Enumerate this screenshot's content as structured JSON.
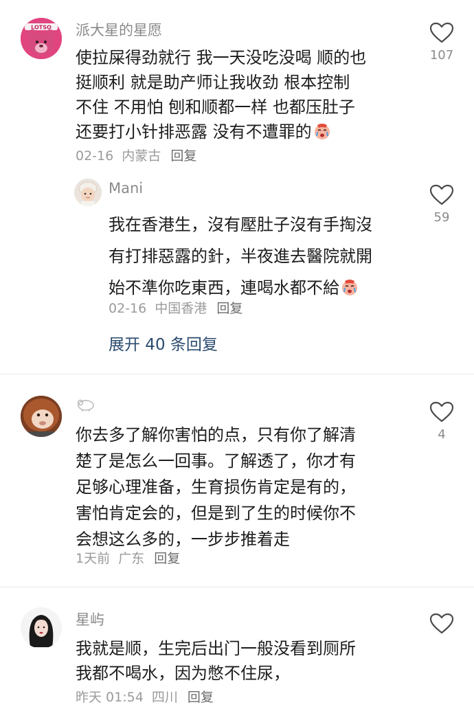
{
  "comments": [
    {
      "username": "派大星的星愿",
      "avatar_icon": "lotso-bear-avatar",
      "lines": [
        "使拉屎得劲就行 我一天没吃没喝 顺的也",
        "挺顺利  就是助产师让我收劲 根本控制",
        "不住 不用怕 刨和顺都一样 也都压肚子",
        "还要打小针排恶露 没有不遭罪的"
      ],
      "emoji": "crying-face-emoji",
      "date": "02-16",
      "location": "内蒙古",
      "reply_label": "回复",
      "likes": "107"
    },
    {
      "username": "Mani",
      "avatar_icon": "baby-avatar",
      "lines": [
        "我在香港生，沒有壓肚子沒有手掏沒",
        "有打排惡露的針，半夜進去醫院就開",
        "始不準你吃東西，連喝水都不給"
      ],
      "emoji": "crying-face-emoji",
      "date": "02-16",
      "location": "中国香港",
      "reply_label": "回复",
      "likes": "59"
    },
    {
      "username": "",
      "avatar_icon": "monkey-avatar",
      "lines": [
        "你去多了解你害怕的点，只有你了解清",
        "楚了是怎么一回事。了解透了，你才有",
        "足够心理准备，生育损伤肯定是有的，",
        "害怕肯定会的，但是到了生的时候你不",
        "会想这么多的，一步步推着走"
      ],
      "date": "1天前",
      "location": "广东",
      "reply_label": "回复",
      "likes": "4"
    },
    {
      "username": "星屿",
      "avatar_icon": "woman-portrait-avatar",
      "lines": [
        "我就是顺，生完后出门一般没看到厕所",
        "我都不喝水，因为憋不住尿，"
      ],
      "date": "昨天 01:54",
      "location": "四川",
      "reply_label": "回复",
      "likes": ""
    }
  ],
  "expand_replies_label": "展开 40 条回复"
}
